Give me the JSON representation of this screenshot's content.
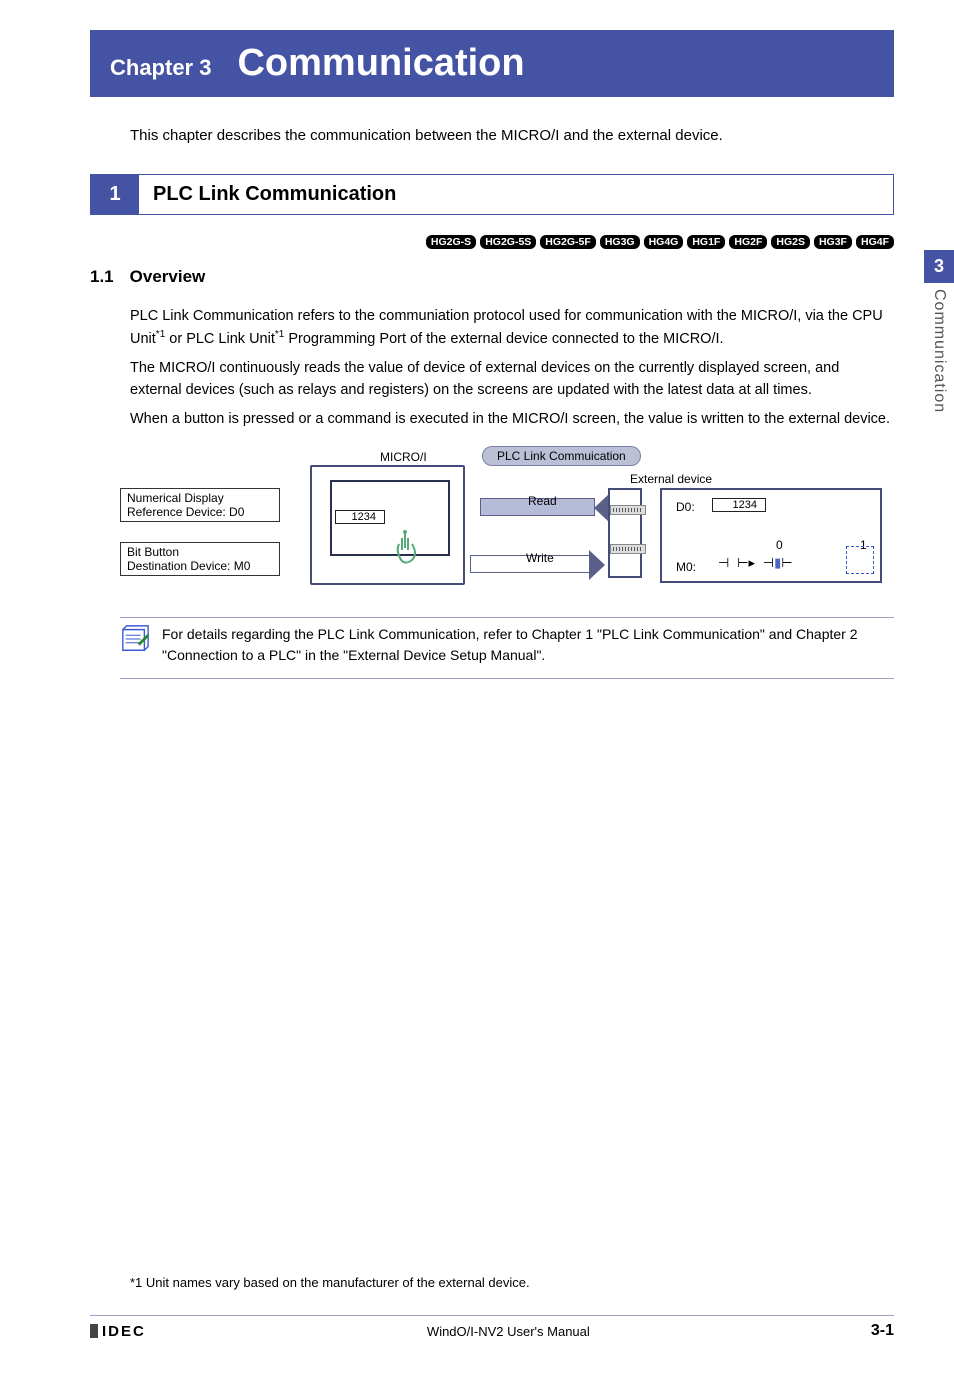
{
  "chapter": {
    "label": "Chapter 3",
    "title": "Communication"
  },
  "intro": "This chapter describes the communication between the MICRO/I and the external device.",
  "section": {
    "num": "1",
    "title": "PLC Link Communication"
  },
  "badges": [
    "HG2G-S",
    "HG2G-5S",
    "HG2G-5F",
    "HG3G",
    "HG4G",
    "HG1F",
    "HG2F",
    "HG2S",
    "HG3F",
    "HG4F"
  ],
  "subsection": {
    "num": "1.1",
    "title": "Overview"
  },
  "paragraphs": {
    "p1a": "PLC Link Communication refers to the communiation protocol used for communication with the MICRO/I, via the CPU Unit",
    "p1b": " or PLC Link Unit",
    "p1c": " Programming Port of the external device connected to the MICRO/I.",
    "p2": "The MICRO/I continuously reads the value of device of external devices on the currently displayed screen, and external devices (such as relays and registers) on the screens are updated with the latest data at all times.",
    "p3": "When a button is pressed or a command is executed in the MICRO/I screen, the value is written to the external device.",
    "supref": "*1"
  },
  "diagram": {
    "microi_label": "MICRO/I",
    "plc_pill": "PLC Link Commuication",
    "ext_label": "External device",
    "num_display_l1": "Numerical Display",
    "num_display_l2": "Reference Device: D0",
    "bit_button_l1": "Bit Button",
    "bit_button_l2": "Destination Device: M0",
    "value": "1234",
    "read": "Read",
    "write": "Write",
    "d0_label": "D0:",
    "d0_value": "1234",
    "zero": "0",
    "one": "1",
    "m0_label": "M0:"
  },
  "note": "For details regarding the PLC Link Communication, refer to Chapter 1 \"PLC Link Communication\" and Chapter 2 \"Connection to a PLC\" in the \"External Device Setup Manual\".",
  "side": {
    "num": "3",
    "label": "Communication"
  },
  "footnote": "*1 Unit names vary based on the manufacturer of the external device.",
  "footer": {
    "brand": "IDEC",
    "manual": "WindO/I-NV2 User's Manual",
    "page": "3-1"
  }
}
